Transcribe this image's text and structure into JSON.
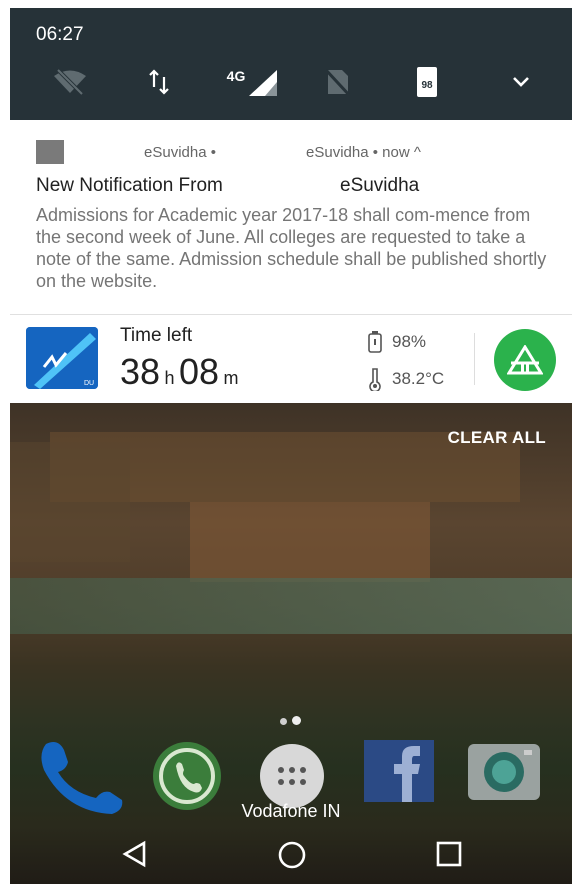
{
  "status": {
    "time": "06:27",
    "network": "4G",
    "battery": "98"
  },
  "notification": {
    "app_name": "eSuvidha",
    "app_header_dot": "eSuvidha •",
    "app_meta": "eSuvidha • now ^",
    "title_prefix": "New Notification From",
    "title_app": "eSuvidha",
    "body": "Admissions for Academic year 2017-18 shall com-mence from the second week of June. All colleges are requested to take a note of the same. Admission schedule shall be published shortly on the website."
  },
  "battery_widget": {
    "label": "Time left",
    "hours": "38",
    "hours_unit": "h",
    "minutes": "08",
    "minutes_unit": "m",
    "battery_percent": "98%",
    "temperature": "38.2°C",
    "accent": "#2bb24c"
  },
  "home": {
    "clear_all": "CLEAR ALL",
    "carrier": "Vodafone IN"
  }
}
